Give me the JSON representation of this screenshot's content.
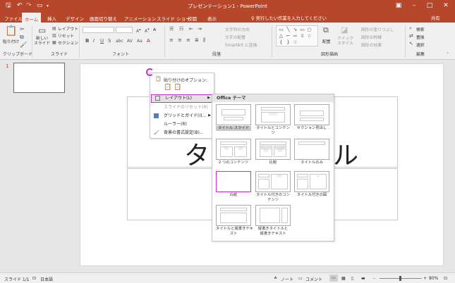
{
  "window": {
    "title": "プレゼンテーション1 - PowerPoint",
    "icons": [
      "save-icon",
      "undo-icon",
      "redo-icon",
      "start-slideshow-icon",
      "customize-qat-icon"
    ]
  },
  "tabs": [
    "ファイル",
    "ホーム",
    "挿入",
    "デザイン",
    "画面切り替え",
    "アニメーション",
    "スライド ショー",
    "校閲",
    "表示"
  ],
  "active_tab": "ホーム",
  "tell_me": "♀ 実行したい作業を入力してください",
  "share": "共有",
  "ribbon": {
    "groups": [
      "クリップボード",
      "スライド",
      "フォント",
      "段落",
      "図形描画",
      "編集"
    ],
    "paste": "貼り付け",
    "new_slide": "新しい\nスライド",
    "layout": "レイアウト",
    "reset": "リセット",
    "section": "セクション",
    "text_direction": "文字列の方向",
    "align_text": "文字の配置",
    "smartart": "SmartArt に変換",
    "arrange": "配置",
    "quick_styles": "クイック\nスタイル",
    "shape_fill": "図形の塗りつぶし",
    "shape_outline": "図形の枠線",
    "shape_effects": "図形の効果",
    "find": "検索",
    "replace": "置換",
    "select": "選択"
  },
  "thumbnails": {
    "number": "1"
  },
  "slide": {
    "title_partial": "タ",
    "title_tail": "ル"
  },
  "context_menu": {
    "paste_options": "貼り付けのオプション:",
    "items": [
      {
        "label": "レイアウト(L)",
        "icon": "layout-icon",
        "highlighted": true,
        "submenu": true
      },
      {
        "label": "スライドのリセット(R)",
        "icon": "",
        "dim": true
      },
      {
        "label": "グリッドとガイド(I)...",
        "icon": "grid-icon",
        "submenu": true
      },
      {
        "label": "ルーラー(R)",
        "icon": ""
      },
      {
        "label": "背景の書式設定(B)...",
        "icon": "background-format-icon"
      }
    ]
  },
  "gallery": {
    "header": "Office テーマ",
    "layouts": [
      {
        "label": "タイトル スライド",
        "current": true
      },
      {
        "label": "タイトルとコンテンツ"
      },
      {
        "label": "セクション見出し"
      },
      {
        "label": "2 つのコンテンツ"
      },
      {
        "label": "比較"
      },
      {
        "label": "タイトルのみ"
      },
      {
        "label": "白紙",
        "selected": true
      },
      {
        "label": "タイトル付きのコンテンツ"
      },
      {
        "label": "タイトル付きの図"
      },
      {
        "label": "タイトルと縦書きテキ\nスト"
      },
      {
        "label": "縦書きタイトルと\n縦書きテキスト"
      }
    ]
  },
  "status": {
    "slide": "スライド 1/1",
    "language": "日本語",
    "notes": "ノート",
    "comments": "コメント",
    "zoom": "80%"
  },
  "colors": {
    "accent": "#b7472a",
    "highlight": "#c82fd3"
  }
}
